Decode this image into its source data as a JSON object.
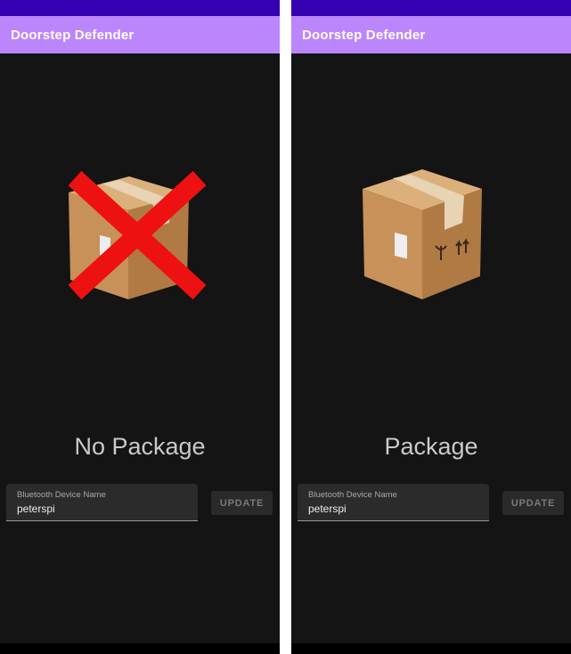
{
  "colors": {
    "status_bar": "#3700b3",
    "app_bar": "#bb86fc",
    "background": "#141414",
    "nav_bar": "#000000",
    "cross": "#ee1111",
    "box": "#c8915a"
  },
  "screens": [
    {
      "app_title": "Doorstep Defender",
      "icon": "package-crossed-icon",
      "state_label": "No Package",
      "field": {
        "label": "Bluetooth Device Name",
        "value": "peterspi"
      },
      "update_label": "UPDATE"
    },
    {
      "app_title": "Doorstep Defender",
      "icon": "package-icon",
      "state_label": "Package",
      "field": {
        "label": "Bluetooth Device Name",
        "value": "peterspi"
      },
      "update_label": "UPDATE"
    }
  ]
}
